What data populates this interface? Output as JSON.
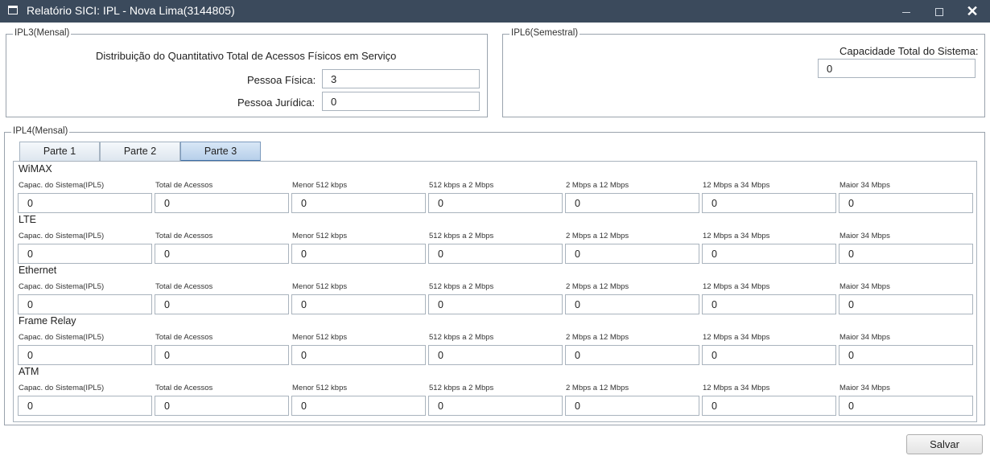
{
  "window": {
    "title": "Relatório SICI: IPL - Nova Lima(3144805)",
    "minimize": "—",
    "maximize": "□",
    "close": "✕"
  },
  "ipl3": {
    "legend": "IPL3(Mensal)",
    "heading": "Distribuição do Quantitativo Total de Acessos Físicos em Serviço",
    "pessoa_fisica_label": "Pessoa Física:",
    "pessoa_fisica_value": "3",
    "pessoa_juridica_label": "Pessoa Jurídica:",
    "pessoa_juridica_value": "0"
  },
  "ipl6": {
    "legend": "IPL6(Semestral)",
    "capacidade_label": "Capacidade Total do Sistema:",
    "capacidade_value": "0"
  },
  "ipl4": {
    "legend": "IPL4(Mensal)",
    "tabs": [
      {
        "label": "Parte 1",
        "active": false
      },
      {
        "label": "Parte 2",
        "active": false
      },
      {
        "label": "Parte 3",
        "active": true
      }
    ],
    "columns": [
      "Capac. do Sistema(IPL5)",
      "Total de Acessos",
      "Menor 512 kbps",
      "512 kbps a 2 Mbps",
      "2 Mbps a 12 Mbps",
      "12 Mbps a 34 Mbps",
      "Maior 34 Mbps"
    ],
    "sections": [
      {
        "title": "WiMAX",
        "values": [
          "0",
          "0",
          "0",
          "0",
          "0",
          "0",
          "0"
        ]
      },
      {
        "title": "LTE",
        "values": [
          "0",
          "0",
          "0",
          "0",
          "0",
          "0",
          "0"
        ]
      },
      {
        "title": "Ethernet",
        "values": [
          "0",
          "0",
          "0",
          "0",
          "0",
          "0",
          "0"
        ]
      },
      {
        "title": "Frame Relay",
        "values": [
          "0",
          "0",
          "0",
          "0",
          "0",
          "0",
          "0"
        ]
      },
      {
        "title": "ATM",
        "values": [
          "0",
          "0",
          "0",
          "0",
          "0",
          "0",
          "0"
        ]
      }
    ]
  },
  "footer": {
    "save_label": "Salvar"
  }
}
